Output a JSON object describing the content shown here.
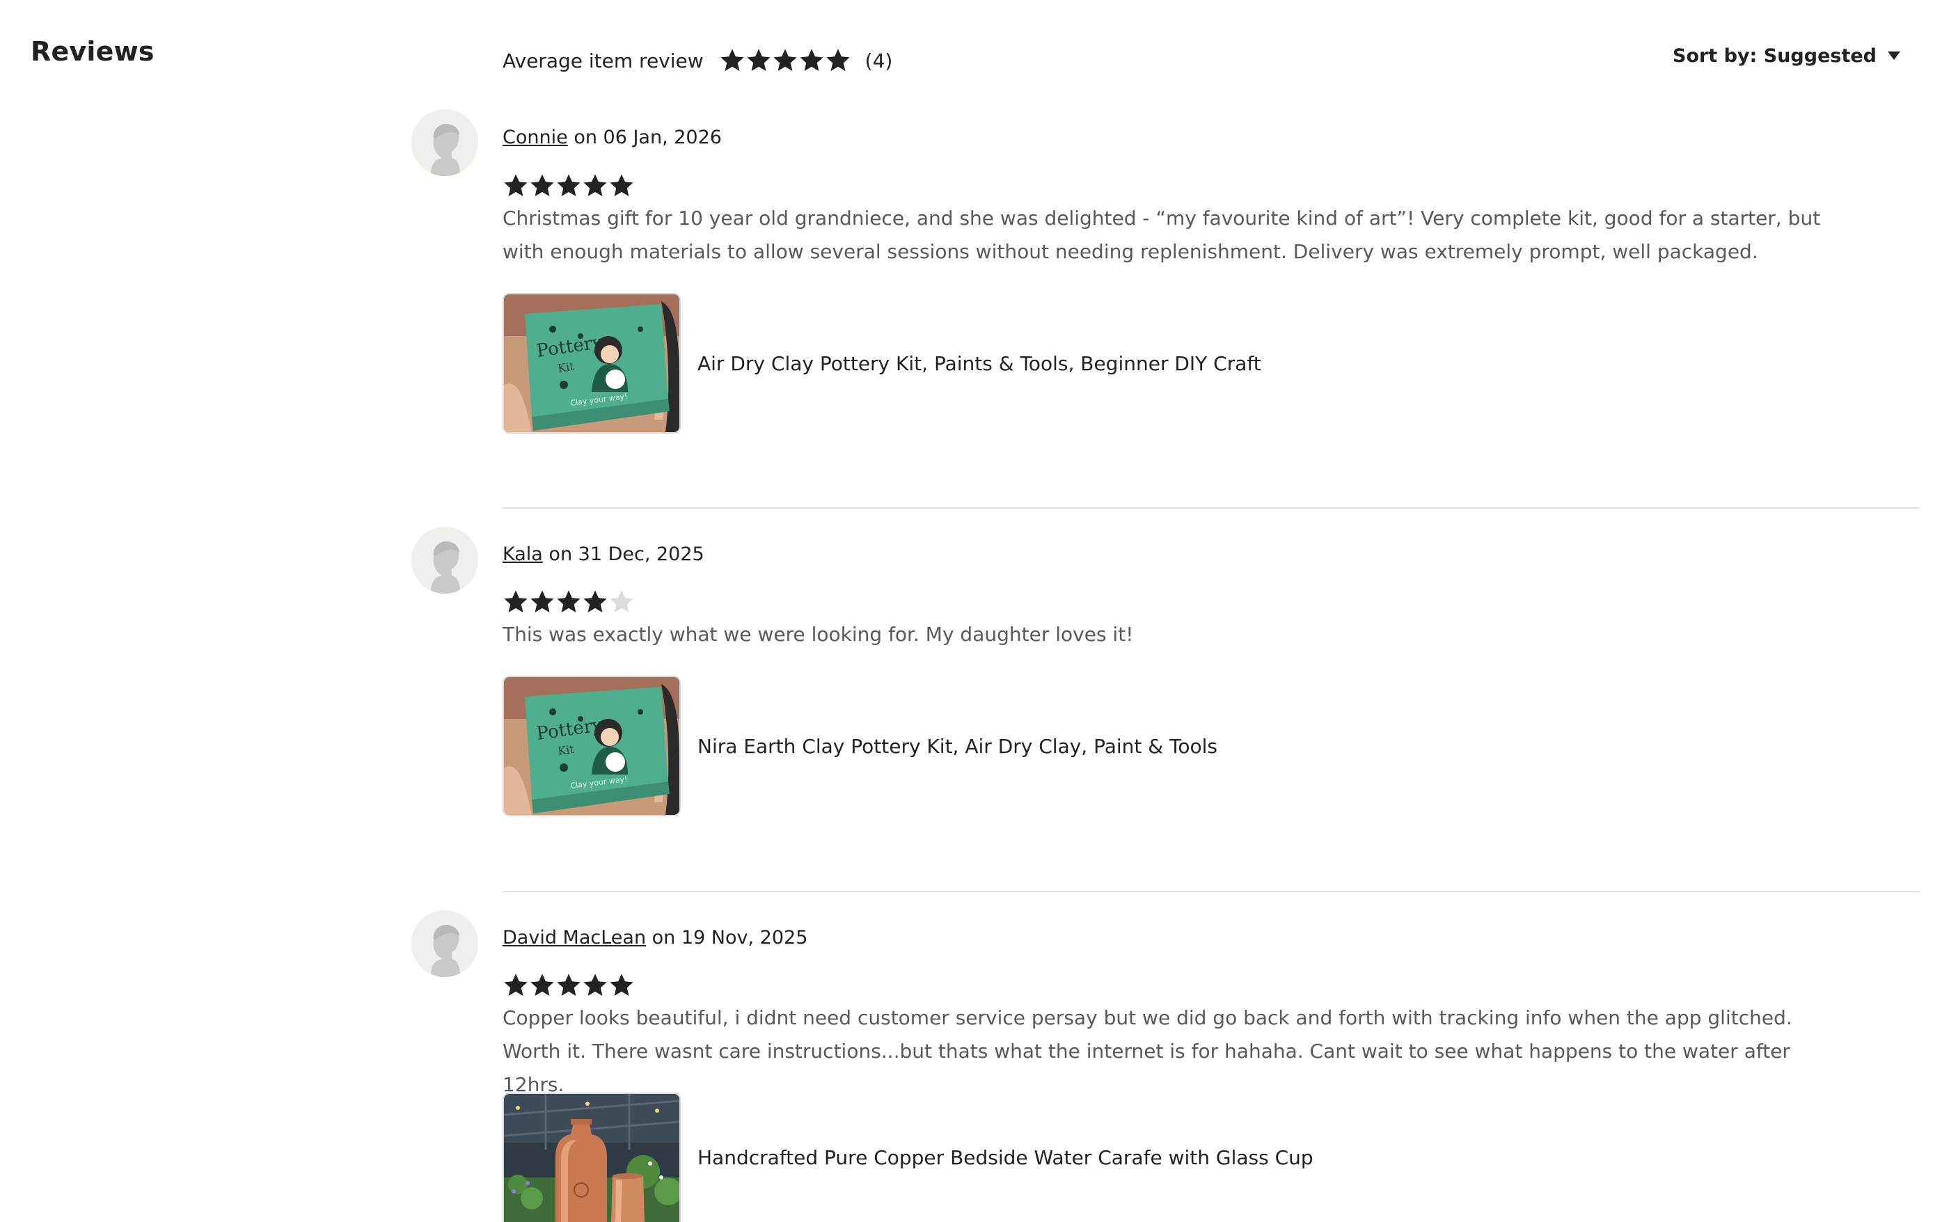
{
  "header": {
    "title": "Reviews",
    "average_label": "Average item review",
    "average_rating": 5,
    "review_count": "(4)",
    "sort_label": "Sort by: Suggested"
  },
  "colors": {
    "star_filled": "#222222",
    "star_empty": "#dcdcdc",
    "text_secondary": "#595959",
    "divider": "#e1e1e1",
    "avatar_bg": "#efefec"
  },
  "reviews": [
    {
      "author": "Connie",
      "date_text": "on 06 Jan, 2026",
      "rating": 5,
      "text": "Christmas gift for 10 year old grandniece, and she was delighted - “my favourite kind of art”! Very complete kit, good for a starter, but with enough materials to allow several sessions without needing replenishment. Delivery was extremely prompt, well packaged.",
      "product_title": "Air Dry Clay Pottery Kit, Paints & Tools, Beginner DIY Craft",
      "product_image": "pottery-kit-box",
      "box_title": "Pottery",
      "box_subtitle": "Kit",
      "box_tagline": "Clay your way!"
    },
    {
      "author": "Kala",
      "date_text": "on 31 Dec, 2025",
      "rating": 4,
      "text": "This was exactly what we were looking for. My daughter loves it!",
      "product_title": "Nira Earth Clay Pottery Kit, Air Dry Clay, Paint & Tools",
      "product_image": "pottery-kit-box",
      "box_title": "Pottery",
      "box_subtitle": "Kit",
      "box_tagline": "Clay your way!"
    },
    {
      "author": "David MacLean",
      "date_text": "on 19 Nov, 2025",
      "rating": 5,
      "text": "Copper looks beautiful, i didnt need customer service persay but we did go back and forth with tracking info when the app glitched. Worth it. There wasnt care instructions...but thats what the internet is for hahaha. Cant wait to see what happens to the water after 12hrs.",
      "product_title": "Handcrafted Pure Copper Bedside Water Carafe with Glass Cup",
      "product_image": "copper-carafe"
    }
  ]
}
